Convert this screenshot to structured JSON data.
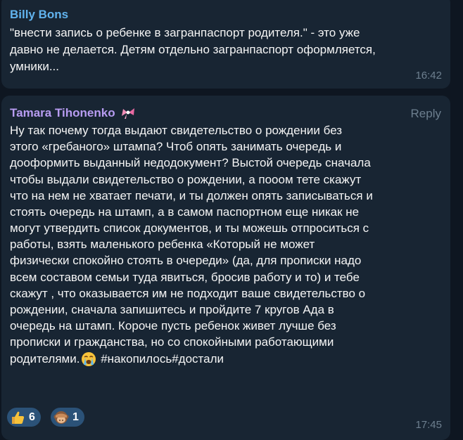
{
  "messages": [
    {
      "author": "Billy Bons",
      "author_color": "#61b3ee",
      "lines": [
        "\"внести запись о ребенке в загранпаспорт родителя.\" - это уже",
        "давно не делается. Детям отдельно загранпаспорт оформляется,",
        "умники..."
      ],
      "time": "16:42"
    },
    {
      "author": "Tamara Tihonenko",
      "author_color": "#b79cf1",
      "author_badge": "pink-bow-icon",
      "reply_label": "Reply",
      "lines": [
        "Ну так почему тогда выдают свидетельство о рождении без",
        "этого «гребаного» штампа? Чтоб опять занимать очередь и",
        "дооформить выданный недодокумент? Выстой очередь сначала",
        "чтобы выдали свидетельство о рождении, а пооом тете скажут",
        "что на нем не хватает печати, и ты должен опять записываться и",
        "стоять очередь на штамп, а в самом паспортном еще никак не",
        "могут утвердить список документов, и ты можешь отпроситься с",
        "работы, взять маленького ребенка «Который не может",
        "физически спокойно стоять в очереди» (да, для прописки надо",
        "всем составом семьи туда явиться, бросив работу и то) и тебе",
        "скажут , что оказывается им не подходит ваше свидетельство о",
        "рождении, сначала запишитесь и пройдите 7 кругов Ада в",
        "очередь на штамп. Короче пусть ребенок живет лучше без",
        "прописки и гражданства, но со спокойными работающими",
        "родителями."
      ],
      "last_line_tail": " #накопилось#достали",
      "last_emoji": "crying-face-icon",
      "reactions": [
        {
          "emoji": "thumbs-up-icon",
          "count": "6"
        },
        {
          "emoji": "see-no-evil-monkey-icon",
          "count": "1"
        }
      ],
      "time": "17:45"
    }
  ],
  "colors": {
    "background": "#0e1621",
    "bubble": "#182533",
    "reaction_bg": "#2b5278",
    "meta_text": "#6d7f8f"
  }
}
